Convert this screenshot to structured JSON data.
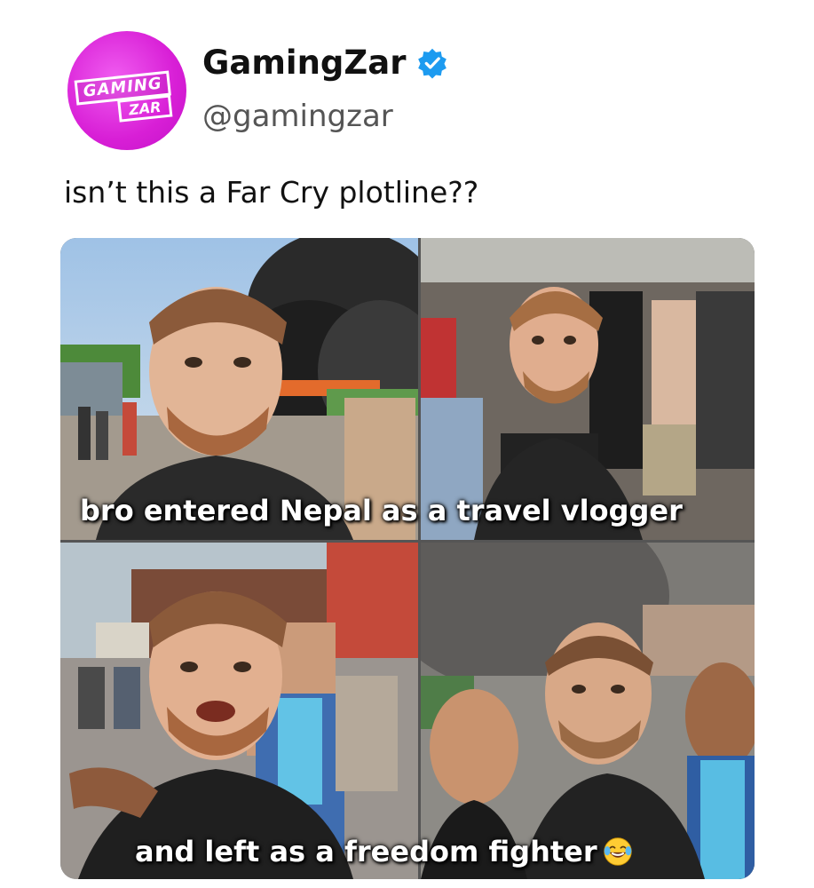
{
  "post": {
    "author_name": "GamingZar",
    "handle": "@gamingzar",
    "verified": true,
    "avatar_logo_line1": "GAMING",
    "avatar_logo_line2": "ZAR",
    "caption": "isn’t this a Far Cry plotline??"
  },
  "meme": {
    "top_text": "bro entered Nepal as a travel vlogger",
    "bottom_text": "and left as a freedom fighter",
    "bottom_emoji": "laughing-crying-emoji"
  },
  "colors": {
    "avatar": "#d81fd6",
    "verified_badge": "#1d9bf0",
    "text_primary": "#111111",
    "text_secondary": "#555555"
  }
}
